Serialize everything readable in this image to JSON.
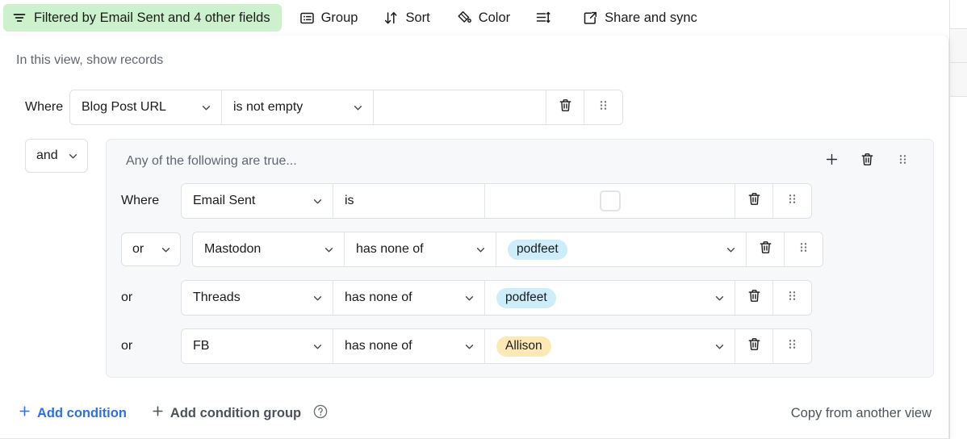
{
  "toolbar": {
    "filter_pill": {
      "icon": "filter-icon",
      "label": "Filtered by Email Sent and 4 other fields",
      "bg_color": "#cdf0cd"
    },
    "items": [
      {
        "icon": "group-icon",
        "label": "Group"
      },
      {
        "icon": "sort-icon",
        "label": "Sort"
      },
      {
        "icon": "color-palette-icon",
        "label": "Color"
      },
      {
        "icon": "row-height-icon",
        "label": ""
      },
      {
        "icon": "share-external-icon",
        "label": "Share and sync"
      }
    ]
  },
  "panel": {
    "title": "In this view, show records",
    "top_condition": {
      "conjunction_label": "Where",
      "field": "Blog Post URL",
      "operator": "is not empty",
      "value": "",
      "delete_icon": "trash-icon",
      "drag_icon": "drag-handle-icon"
    },
    "group": {
      "conjunction": "and",
      "header_title": "Any of the following are true...",
      "add_icon": "plus-icon",
      "delete_icon": "trash-icon",
      "drag_icon": "drag-handle-icon",
      "conditions": [
        {
          "conjunction_label": "Where",
          "conjunction_type": "label",
          "field": "Email Sent",
          "operator": "is",
          "operator_has_chevron": false,
          "value_type": "checkbox",
          "value": "",
          "checkbox_checked": false
        },
        {
          "conjunction_label": "or",
          "conjunction_type": "select",
          "field": "Mastodon",
          "operator": "has none of",
          "operator_has_chevron": true,
          "value_type": "tag",
          "value": "podfeet",
          "tag_color": "#cdedfb"
        },
        {
          "conjunction_label": "or",
          "conjunction_type": "label",
          "field": "Threads",
          "operator": "has none of",
          "operator_has_chevron": true,
          "value_type": "tag",
          "value": "podfeet",
          "tag_color": "#cdedfb"
        },
        {
          "conjunction_label": "or",
          "conjunction_type": "label",
          "field": "FB",
          "operator": "has none of",
          "operator_has_chevron": true,
          "value_type": "tag",
          "value": "Allison",
          "tag_color": "#fde9b5"
        }
      ]
    },
    "footer": {
      "add_condition": "Add condition",
      "add_condition_group": "Add condition group",
      "help_icon": "question-circle-icon",
      "copy_from_another_view": "Copy from another view",
      "primary_color": "#2f6fed"
    }
  }
}
